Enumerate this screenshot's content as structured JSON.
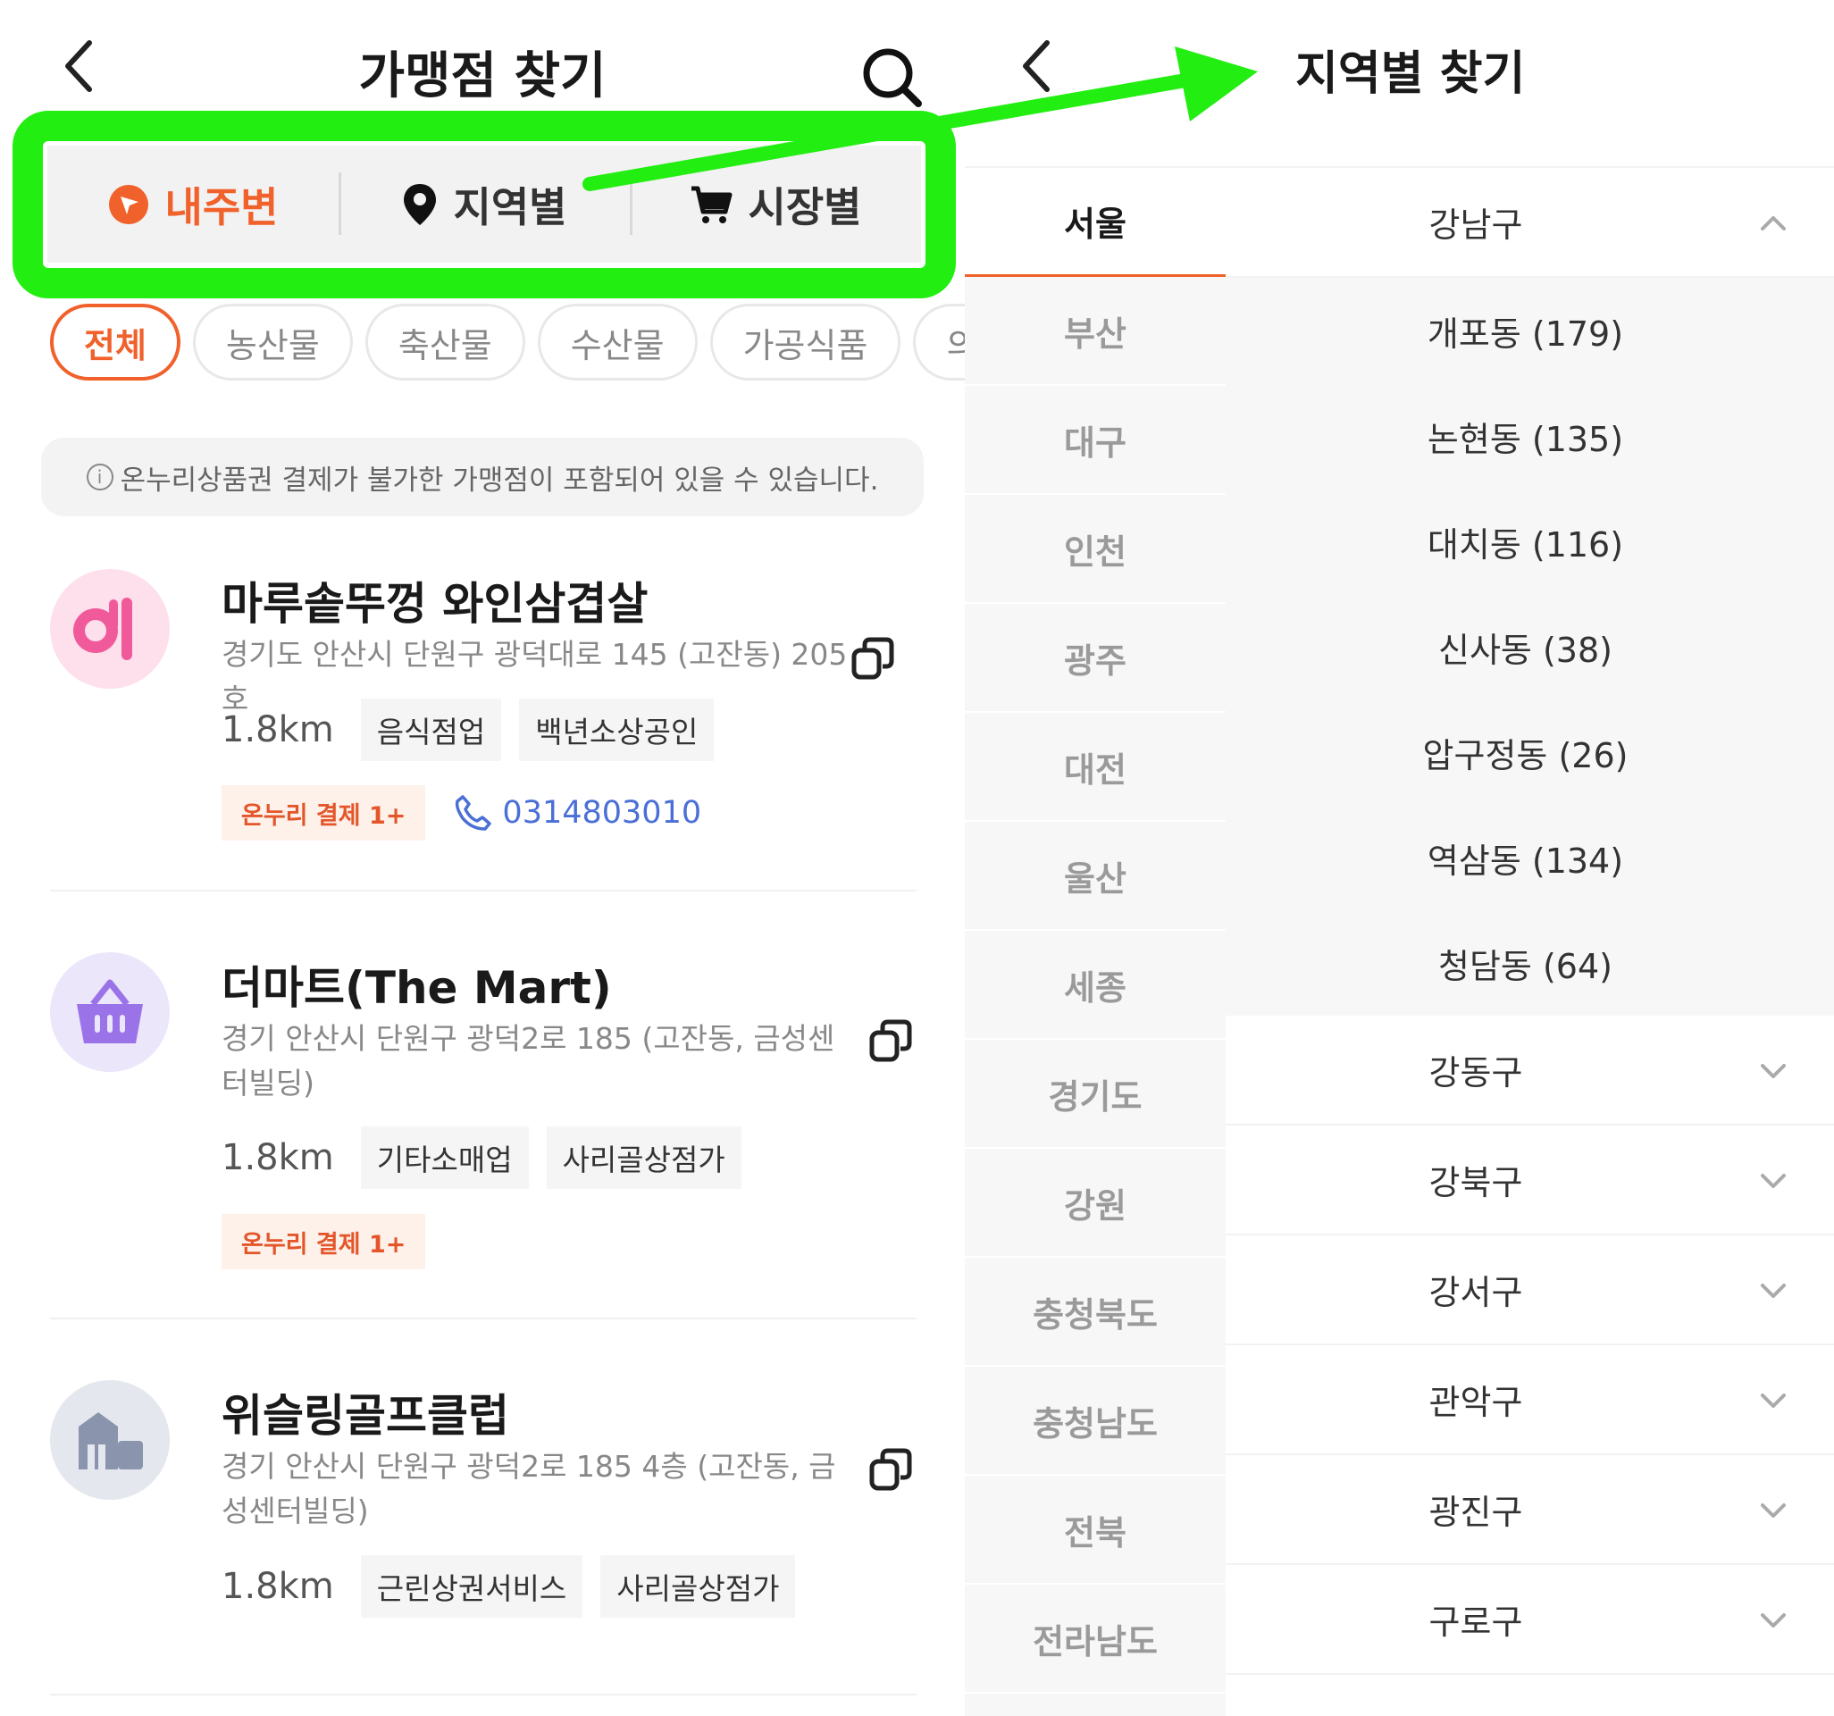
{
  "left": {
    "title": "가맹점 찾기",
    "tabs": [
      {
        "label": "내주변",
        "icon": "nearby-icon",
        "active": true
      },
      {
        "label": "지역별",
        "icon": "location-pin-icon",
        "active": false
      },
      {
        "label": "시장별",
        "icon": "cart-icon",
        "active": false
      }
    ],
    "chips": [
      "전체",
      "농산물",
      "축산물",
      "수산물",
      "가공식품",
      "의류"
    ],
    "notice": "온누리상품권 결제가 불가한 가맹점이 포함되어 있을 수 있습니다.",
    "stores": [
      {
        "name": "마루솥뚜껑 와인삼겹살",
        "address": "경기도 안산시 단원구 광덕대로 145 (고잔동) 205호",
        "distance": "1.8km",
        "tags": [
          "음식점업",
          "백년소상공인"
        ],
        "badge": "온누리 결제 1+",
        "phone": "0314803010",
        "icon": "restaurant-icon"
      },
      {
        "name": "더마트(The Mart)",
        "address": "경기 안산시 단원구 광덕2로 185 (고잔동, 금성센터빌딩)",
        "distance": "1.8km",
        "tags": [
          "기타소매업",
          "사리골상점가"
        ],
        "badge": "온누리 결제 1+",
        "icon": "shopping-basket-icon"
      },
      {
        "name": "위슬링골프클럽",
        "address": "경기 안산시 단원구 광덕2로 185 4층 (고잔동, 금성센터빌딩)",
        "distance": "1.8km",
        "tags": [
          "근린상권서비스",
          "사리골상점가"
        ],
        "icon": "building-icon"
      }
    ]
  },
  "right": {
    "title": "지역별 찾기",
    "regions": [
      "서울",
      "부산",
      "대구",
      "인천",
      "광주",
      "대전",
      "울산",
      "세종",
      "경기도",
      "강원",
      "충청북도",
      "충청남도",
      "전북",
      "전라남도"
    ],
    "selected_region": "서울",
    "expanded_district": {
      "name": "강남구",
      "subs": [
        "개포동 (179)",
        "논현동 (135)",
        "대치동 (116)",
        "신사동 (38)",
        "압구정동 (26)",
        "역삼동 (134)",
        "청담동 (64)"
      ]
    },
    "districts": [
      "강동구",
      "강북구",
      "강서구",
      "관악구",
      "광진구",
      "구로구"
    ]
  },
  "colors": {
    "accent": "#f0612b",
    "highlight": "#22ee11",
    "phone": "#4a6fd6"
  }
}
